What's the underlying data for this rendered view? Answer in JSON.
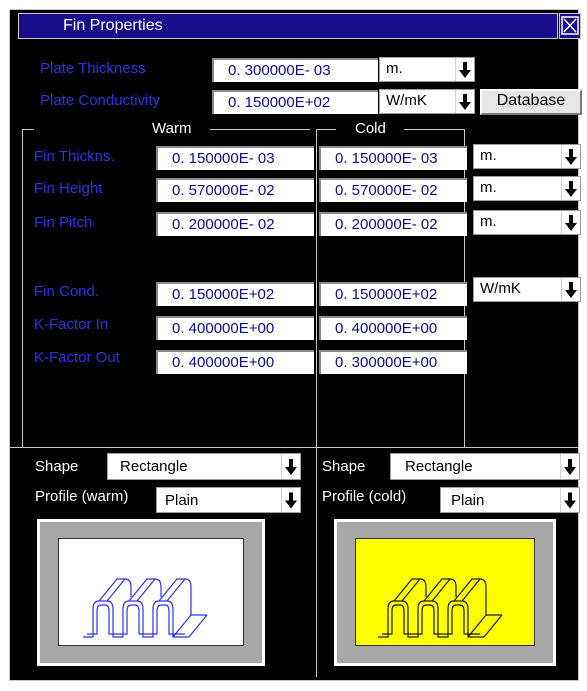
{
  "title": "Fin Properties",
  "plate": {
    "thickness_label": "Plate Thickness",
    "thickness_value": "0. 300000E- 03",
    "thickness_unit": "m.",
    "conductivity_label": "Plate Conductivity",
    "conductivity_value": "0. 150000E+02",
    "conductivity_unit": "W/mK",
    "database_label": "Database"
  },
  "columns": {
    "warm": "Warm",
    "cold": "Cold"
  },
  "rows": [
    {
      "label": "Fin Thickns.",
      "warm": "0. 150000E- 03",
      "cold": "0. 150000E- 03",
      "unit": "m."
    },
    {
      "label": "Fin Height",
      "warm": "0. 570000E- 02",
      "cold": "0. 570000E- 02",
      "unit": "m."
    },
    {
      "label": "Fin Pitch",
      "warm": "0. 200000E- 02",
      "cold": "0. 200000E- 02",
      "unit": "m."
    },
    {
      "label": "Fin Cond.",
      "warm": "0. 150000E+02",
      "cold": "0. 150000E+02",
      "unit": "W/mK"
    },
    {
      "label": "K-Factor In",
      "warm": "0. 400000E+00",
      "cold": "0. 400000E+00"
    },
    {
      "label": "K-Factor Out",
      "warm": "0. 400000E+00",
      "cold": "0. 300000E+00"
    }
  ],
  "warm_shape": {
    "shape_label": "Shape",
    "shape_value": "Rectangle",
    "profile_label": "Profile (warm)",
    "profile_value": "Plain",
    "preview_bg": "#ffffff"
  },
  "cold_shape": {
    "shape_label": "Shape",
    "shape_value": "Rectangle",
    "profile_label": "Profile (cold)",
    "profile_value": "Plain",
    "preview_bg": "#ffff00"
  },
  "icons": {
    "close": "close-icon",
    "dropdown": "down-arrow-icon",
    "fin": "fin-profile-icon"
  },
  "colors": {
    "label_blue": "#2f33e8",
    "title_bg": "#1a0d8c",
    "value_text": "#0b0b8f"
  }
}
